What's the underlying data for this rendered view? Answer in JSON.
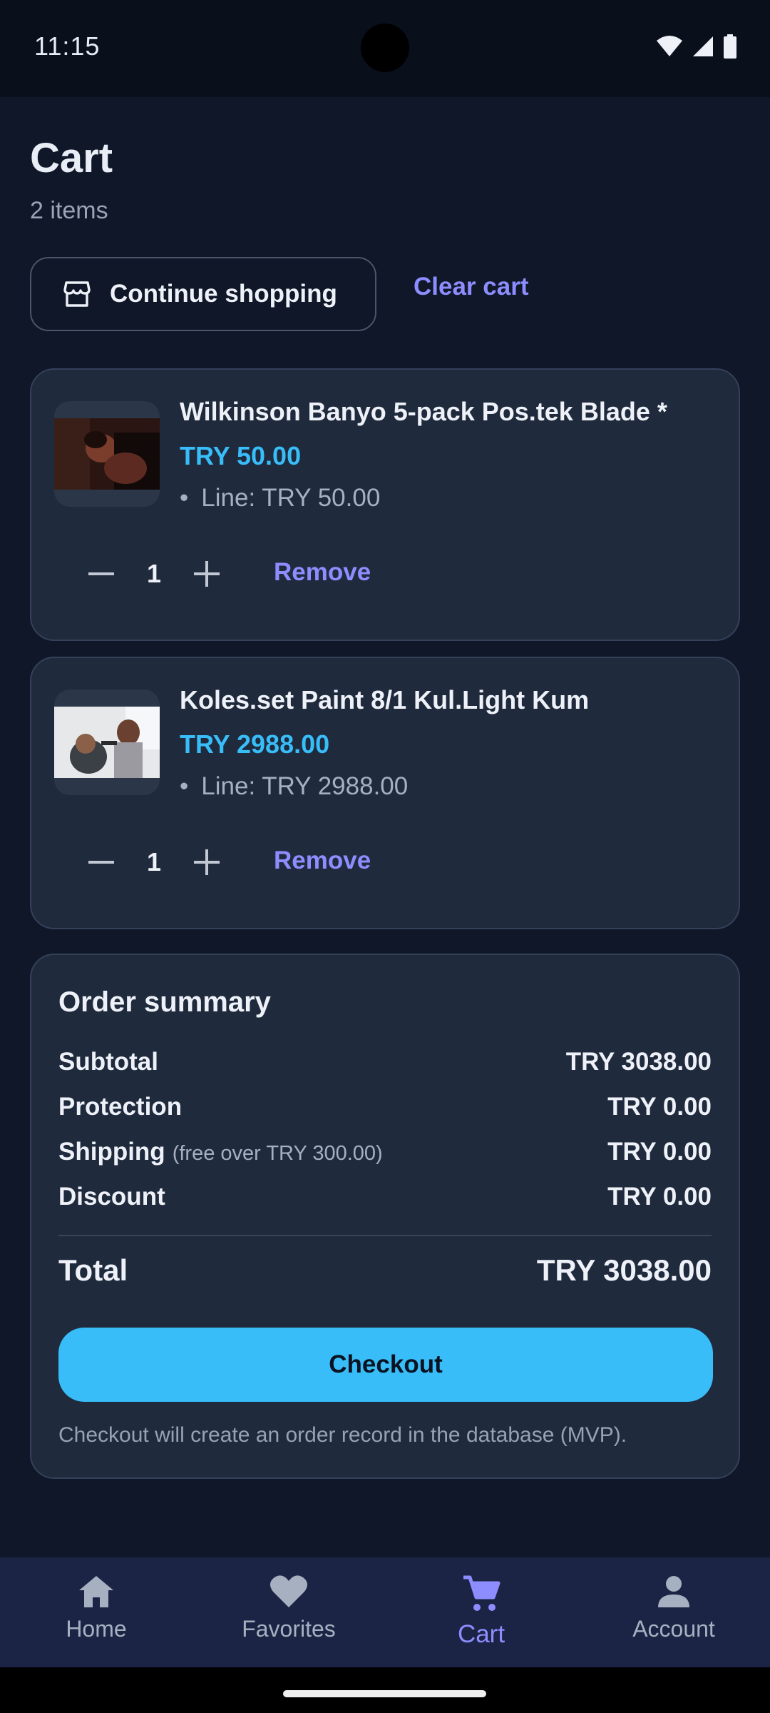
{
  "status_bar": {
    "time": "11:15"
  },
  "header": {
    "title": "Cart",
    "item_count": "2 items"
  },
  "actions": {
    "continue_label": "Continue shopping",
    "clear_label": "Clear cart"
  },
  "items": [
    {
      "name": "Wilkinson Banyo 5-pack Pos.tek Blade *",
      "price": "TRY 50.00",
      "line": "Line: TRY 50.00",
      "quantity": "1",
      "remove_label": "Remove"
    },
    {
      "name": "Koles.set Paint 8/1 Kul.Light Kum",
      "price": "TRY 2988.00",
      "line": "Line: TRY 2988.00",
      "quantity": "1",
      "remove_label": "Remove"
    }
  ],
  "summary": {
    "title": "Order summary",
    "subtotal_label": "Subtotal",
    "subtotal_value": "TRY 3038.00",
    "protection_label": "Protection",
    "protection_value": "TRY 0.00",
    "shipping_label": "Shipping",
    "shipping_note": "(free over TRY 300.00)",
    "shipping_value": "TRY 0.00",
    "discount_label": "Discount",
    "discount_value": "TRY 0.00",
    "total_label": "Total",
    "total_value": "TRY 3038.00",
    "checkout_label": "Checkout",
    "checkout_note": "Checkout will create an order record in the database (MVP)."
  },
  "nav": [
    {
      "label": "Home",
      "icon": "home-icon"
    },
    {
      "label": "Favorites",
      "icon": "heart-icon"
    },
    {
      "label": "Cart",
      "icon": "cart-icon",
      "active": true
    },
    {
      "label": "Account",
      "icon": "person-icon"
    }
  ],
  "colors": {
    "accent": "#38bdf8",
    "link": "#8e8dff",
    "background": "#0f1728",
    "card": "#1f2a3d"
  }
}
